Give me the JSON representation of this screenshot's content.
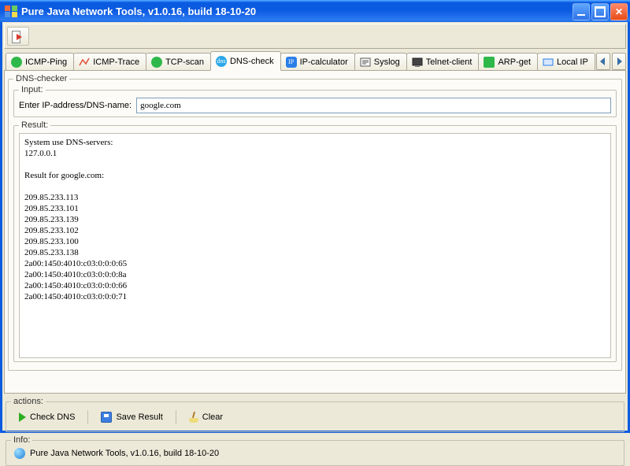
{
  "window": {
    "title": "Pure Java Network Tools,  v1.0.16, build 18-10-20"
  },
  "tabs": [
    {
      "label": "ICMP-Ping",
      "icon_color": "#2FB84A"
    },
    {
      "label": "ICMP-Trace",
      "icon_color": "#E0503A"
    },
    {
      "label": "TCP-scan",
      "icon_color": "#2FB84A"
    },
    {
      "label": "DNS-check",
      "icon_color": "#2BA8E8",
      "active": true
    },
    {
      "label": "IP-calculator",
      "icon_color": "#2B7EE8"
    },
    {
      "label": "Syslog",
      "icon_color": "#555555"
    },
    {
      "label": "Telnet-client",
      "icon_color": "#555555"
    },
    {
      "label": "ARP-get",
      "icon_color": "#2FB84A"
    },
    {
      "label": "Local IP",
      "icon_color": "#2B7EE8"
    }
  ],
  "panel": {
    "title": "DNS-checker",
    "input": {
      "section_label": "Input:",
      "field_label": "Enter IP-address/DNS-name:",
      "value": "google.com"
    },
    "result": {
      "section_label": "Result:",
      "text": "System use DNS-servers:\n127.0.0.1\n\nResult for google.com:\n\n209.85.233.113\n209.85.233.101\n209.85.233.139\n209.85.233.102\n209.85.233.100\n209.85.233.138\n2a00:1450:4010:c03:0:0:0:65\n2a00:1450:4010:c03:0:0:0:8a\n2a00:1450:4010:c03:0:0:0:66\n2a00:1450:4010:c03:0:0:0:71"
    }
  },
  "actions": {
    "section_label": "actions:",
    "check": "Check DNS",
    "save": "Save Result",
    "clear": "Clear"
  },
  "info": {
    "section_label": "Info:",
    "text": "Pure Java Network Tools,  v1.0.16, build 18-10-20"
  },
  "colors": {
    "accent": "#0B5BE0",
    "panel": "#ECE9D8"
  }
}
